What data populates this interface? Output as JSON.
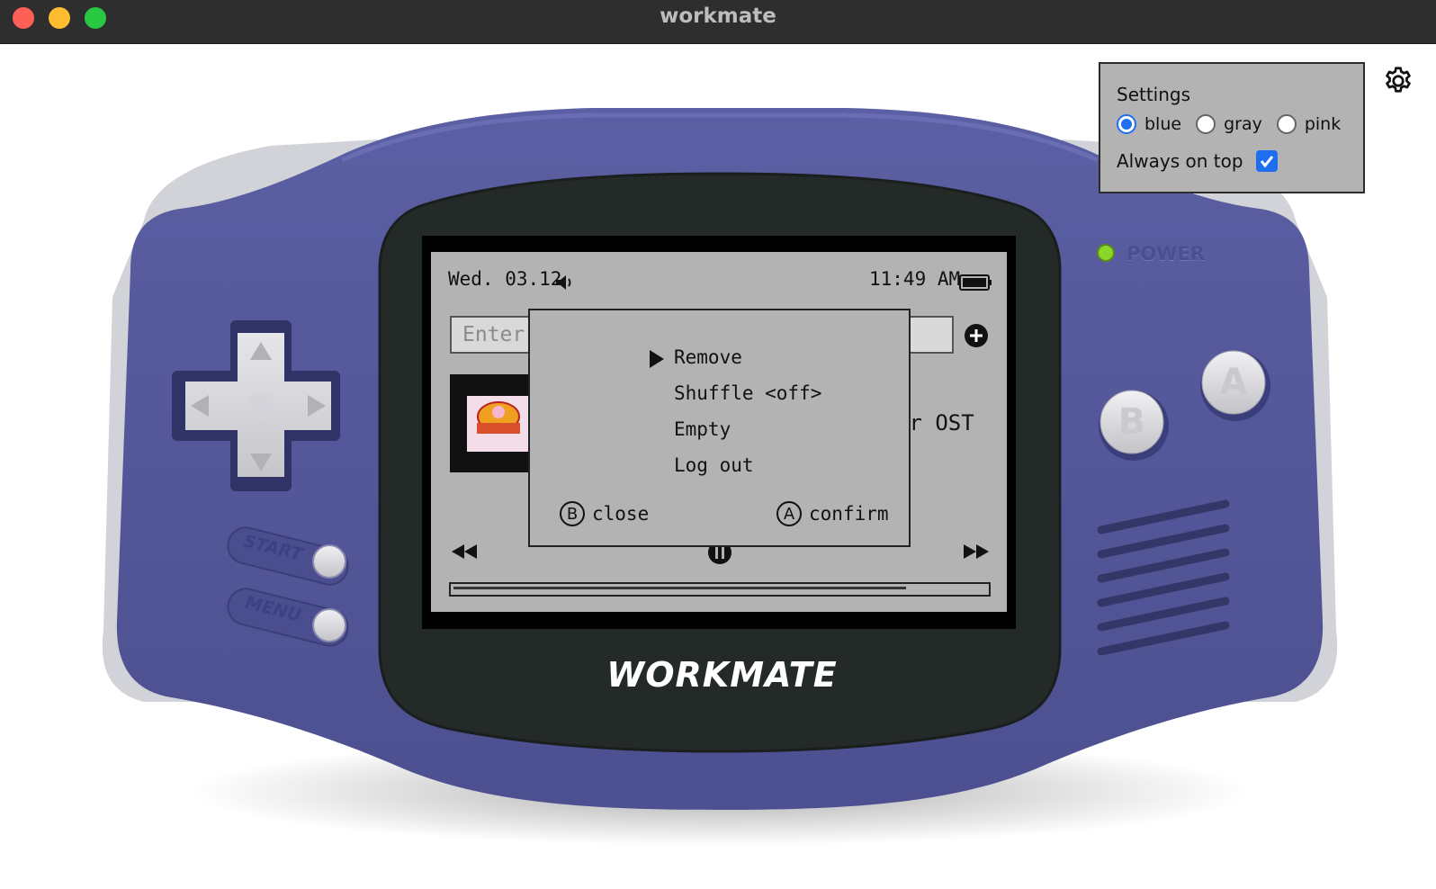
{
  "window": {
    "title": "workmate"
  },
  "settings": {
    "title": "Settings",
    "themes": [
      {
        "label": "blue",
        "selected": true
      },
      {
        "label": "gray",
        "selected": false
      },
      {
        "label": "pink",
        "selected": false
      }
    ],
    "always_on_top": {
      "label": "Always on top",
      "checked": true
    },
    "gear_icon": "gear-icon"
  },
  "screen": {
    "date": "Wed. 03.12",
    "time": "11:49 AM",
    "input_placeholder": "Enter",
    "track_title_fragment": "ar OST",
    "playback_progress": 0.85
  },
  "menu": {
    "items": [
      "Remove",
      "Shuffle <off>",
      "Empty",
      "Log out"
    ],
    "selected_index": 0,
    "close_button": {
      "icon": "B",
      "label": "close"
    },
    "confirm_button": {
      "icon": "A",
      "label": "confirm"
    }
  },
  "device": {
    "brand": "WORKMATE",
    "power_label": "POWER",
    "start_label": "START",
    "menu_label": "MENU",
    "a_label": "A",
    "b_label": "B",
    "body_color": "#525596",
    "screen_bezel_color": "#232a28",
    "lcd_color": "#b3b3b3",
    "power_led_color": "#8ad62a"
  }
}
